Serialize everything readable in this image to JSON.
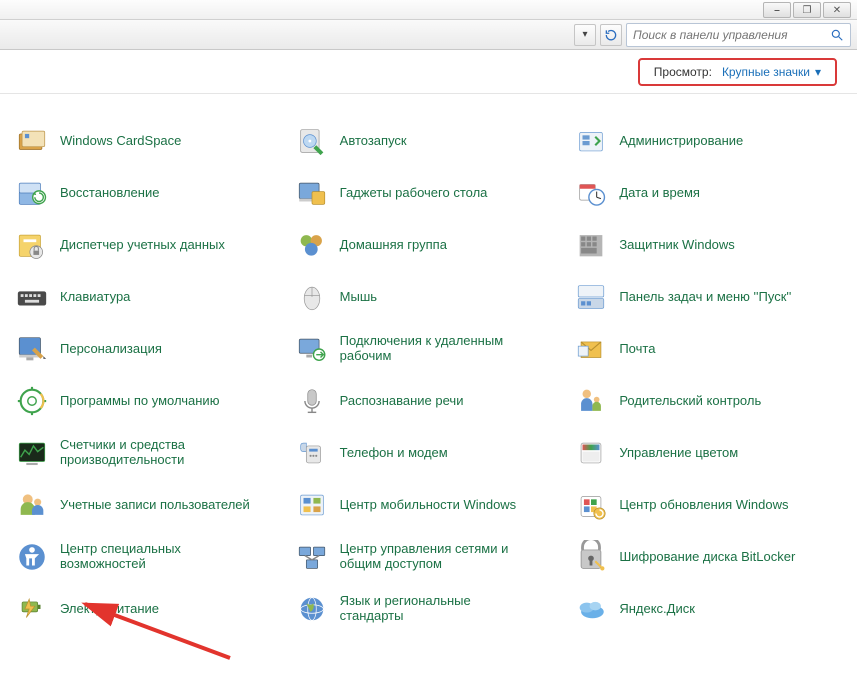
{
  "window": {
    "minimize": "⎯",
    "maximize": "❐",
    "close": "✕"
  },
  "toolbar": {
    "dropdown_icon": "▾",
    "refresh_icon": "↻"
  },
  "search": {
    "placeholder": "Поиск в панели управления"
  },
  "view": {
    "label": "Просмотр:",
    "value": "Крупные значки"
  },
  "items": [
    {
      "label": "Windows CardSpace",
      "icon": "cardspace"
    },
    {
      "label": "Автозапуск",
      "icon": "autoplay"
    },
    {
      "label": "Администрирование",
      "icon": "admin"
    },
    {
      "label": "Восстановление",
      "icon": "recovery"
    },
    {
      "label": "Гаджеты рабочего стола",
      "icon": "gadgets"
    },
    {
      "label": "Дата и время",
      "icon": "datetime"
    },
    {
      "label": "Диспетчер учетных данных",
      "icon": "creds"
    },
    {
      "label": "Домашняя группа",
      "icon": "homegroup"
    },
    {
      "label": "Защитник Windows",
      "icon": "defender"
    },
    {
      "label": "Клавиатура",
      "icon": "keyboard"
    },
    {
      "label": "Мышь",
      "icon": "mouse"
    },
    {
      "label": "Панель задач и меню ''Пуск''",
      "icon": "taskbar"
    },
    {
      "label": "Персонализация",
      "icon": "personalize"
    },
    {
      "label": "Подключения к удаленным рабочим",
      "icon": "remote"
    },
    {
      "label": "Почта",
      "icon": "mail"
    },
    {
      "label": "Программы по умолчанию",
      "icon": "defprog"
    },
    {
      "label": "Распознавание речи",
      "icon": "speech"
    },
    {
      "label": "Родительский контроль",
      "icon": "parental"
    },
    {
      "label": "Счетчики и средства производительности",
      "icon": "perf"
    },
    {
      "label": "Телефон и модем",
      "icon": "phone"
    },
    {
      "label": "Управление цветом",
      "icon": "color"
    },
    {
      "label": "Учетные записи пользователей",
      "icon": "users"
    },
    {
      "label": "Центр мобильности Windows",
      "icon": "mobility"
    },
    {
      "label": "Центр обновления Windows",
      "icon": "update"
    },
    {
      "label": "Центр специальных возможностей",
      "icon": "ease"
    },
    {
      "label": "Центр управления сетями и общим доступом",
      "icon": "network"
    },
    {
      "label": "Шифрование диска BitLocker",
      "icon": "bitlocker"
    },
    {
      "label": "Электропитание",
      "icon": "power"
    },
    {
      "label": "Язык и региональные стандарты",
      "icon": "region"
    },
    {
      "label": "Яндекс.Диск",
      "icon": "yadisk"
    }
  ]
}
